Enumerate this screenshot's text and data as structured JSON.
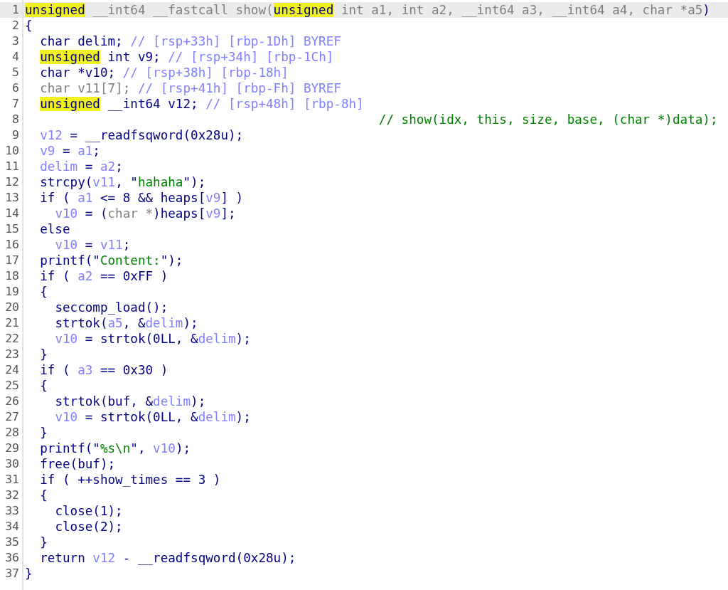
{
  "pseudocode": {
    "lines": [
      {
        "number": "1",
        "selected": true,
        "tokens": [
          {
            "kind": "highlight",
            "text": "unsigned"
          },
          {
            "kind": "dim",
            "text": " __int64 __fastcall show("
          },
          {
            "kind": "highlight",
            "text": "unsigned"
          },
          {
            "kind": "dim",
            "text": " int a1, int a2, __int64 a3, __int64 a4, char *a5"
          },
          {
            "kind": "code",
            "text": ")"
          }
        ]
      },
      {
        "number": "2",
        "selected": false,
        "tokens": [
          {
            "kind": "code",
            "text": "{"
          }
        ]
      },
      {
        "number": "3",
        "selected": false,
        "tokens": [
          {
            "kind": "code",
            "text": "  char delim; "
          },
          {
            "kind": "comment",
            "text": "// [rsp+33h] [rbp-1Dh] BYREF"
          }
        ]
      },
      {
        "number": "4",
        "selected": false,
        "tokens": [
          {
            "kind": "highlight",
            "text": "  unsigned"
          },
          {
            "kind": "code",
            "text": " int v9; "
          },
          {
            "kind": "comment",
            "text": "// [rsp+34h] [rbp-1Ch]"
          }
        ]
      },
      {
        "number": "5",
        "selected": false,
        "tokens": [
          {
            "kind": "code",
            "text": "  char *v10; "
          },
          {
            "kind": "comment",
            "text": "// [rsp+38h] [rbp-18h]"
          }
        ]
      },
      {
        "number": "6",
        "selected": false,
        "tokens": [
          {
            "kind": "dim",
            "text": "  char v11[7]; "
          },
          {
            "kind": "comment",
            "text": "// [rsp+41h] [rbp-Fh] BYREF"
          }
        ]
      },
      {
        "number": "7",
        "selected": false,
        "tokens": [
          {
            "kind": "highlight",
            "text": "  unsigned"
          },
          {
            "kind": "code",
            "text": " __int64 v12; "
          },
          {
            "kind": "comment",
            "text": "// [rsp+48h] [rbp-8h]"
          }
        ]
      },
      {
        "number": "8",
        "selected": false,
        "tokens": [
          {
            "kind": "note",
            "text": "                                               // show(idx, this, size, base, (char *)data);"
          }
        ]
      },
      {
        "number": "9",
        "selected": false,
        "tokens": [
          {
            "kind": "var",
            "text": "  v12"
          },
          {
            "kind": "code",
            "text": " = __readfsqword(0x28u);"
          }
        ]
      },
      {
        "number": "10",
        "selected": false,
        "tokens": [
          {
            "kind": "var",
            "text": "  v9"
          },
          {
            "kind": "code",
            "text": " = "
          },
          {
            "kind": "var",
            "text": "a1"
          },
          {
            "kind": "code",
            "text": ";"
          }
        ]
      },
      {
        "number": "11",
        "selected": false,
        "tokens": [
          {
            "kind": "var",
            "text": "  delim"
          },
          {
            "kind": "code",
            "text": " = "
          },
          {
            "kind": "var",
            "text": "a2"
          },
          {
            "kind": "code",
            "text": ";"
          }
        ]
      },
      {
        "number": "12",
        "selected": false,
        "tokens": [
          {
            "kind": "code",
            "text": "  strcpy("
          },
          {
            "kind": "var",
            "text": "v11"
          },
          {
            "kind": "code",
            "text": ", \""
          },
          {
            "kind": "string",
            "text": "hahaha"
          },
          {
            "kind": "code",
            "text": "\");"
          }
        ]
      },
      {
        "number": "13",
        "selected": false,
        "tokens": [
          {
            "kind": "code",
            "text": "  if ( "
          },
          {
            "kind": "var",
            "text": "a1"
          },
          {
            "kind": "code",
            "text": " <= 8 && heaps["
          },
          {
            "kind": "var",
            "text": "v9"
          },
          {
            "kind": "code",
            "text": "] )"
          }
        ]
      },
      {
        "number": "14",
        "selected": false,
        "tokens": [
          {
            "kind": "var",
            "text": "    v10"
          },
          {
            "kind": "code",
            "text": " = ("
          },
          {
            "kind": "dim",
            "text": "char *"
          },
          {
            "kind": "code",
            "text": ")heaps["
          },
          {
            "kind": "var",
            "text": "v9"
          },
          {
            "kind": "code",
            "text": "];"
          }
        ]
      },
      {
        "number": "15",
        "selected": false,
        "tokens": [
          {
            "kind": "code",
            "text": "  else"
          }
        ]
      },
      {
        "number": "16",
        "selected": false,
        "tokens": [
          {
            "kind": "var",
            "text": "    v10"
          },
          {
            "kind": "code",
            "text": " = "
          },
          {
            "kind": "var",
            "text": "v11"
          },
          {
            "kind": "code",
            "text": ";"
          }
        ]
      },
      {
        "number": "17",
        "selected": false,
        "tokens": [
          {
            "kind": "code",
            "text": "  printf(\""
          },
          {
            "kind": "string",
            "text": "Content:"
          },
          {
            "kind": "code",
            "text": "\");"
          }
        ]
      },
      {
        "number": "18",
        "selected": false,
        "tokens": [
          {
            "kind": "code",
            "text": "  if ( "
          },
          {
            "kind": "var",
            "text": "a2"
          },
          {
            "kind": "code",
            "text": " == 0xFF )"
          }
        ]
      },
      {
        "number": "19",
        "selected": false,
        "tokens": [
          {
            "kind": "code",
            "text": "  {"
          }
        ]
      },
      {
        "number": "20",
        "selected": false,
        "tokens": [
          {
            "kind": "code",
            "text": "    seccomp_load();"
          }
        ]
      },
      {
        "number": "21",
        "selected": false,
        "tokens": [
          {
            "kind": "code",
            "text": "    strtok("
          },
          {
            "kind": "var",
            "text": "a5"
          },
          {
            "kind": "code",
            "text": ", &"
          },
          {
            "kind": "var",
            "text": "delim"
          },
          {
            "kind": "code",
            "text": ");"
          }
        ]
      },
      {
        "number": "22",
        "selected": false,
        "tokens": [
          {
            "kind": "var",
            "text": "    v10"
          },
          {
            "kind": "code",
            "text": " = strtok(0LL, &"
          },
          {
            "kind": "var",
            "text": "delim"
          },
          {
            "kind": "code",
            "text": ");"
          }
        ]
      },
      {
        "number": "23",
        "selected": false,
        "tokens": [
          {
            "kind": "code",
            "text": "  }"
          }
        ]
      },
      {
        "number": "24",
        "selected": false,
        "tokens": [
          {
            "kind": "code",
            "text": "  if ( "
          },
          {
            "kind": "var",
            "text": "a3"
          },
          {
            "kind": "code",
            "text": " == 0x30 )"
          }
        ]
      },
      {
        "number": "25",
        "selected": false,
        "tokens": [
          {
            "kind": "code",
            "text": "  {"
          }
        ]
      },
      {
        "number": "26",
        "selected": false,
        "tokens": [
          {
            "kind": "code",
            "text": "    strtok(buf, &"
          },
          {
            "kind": "var",
            "text": "delim"
          },
          {
            "kind": "code",
            "text": ");"
          }
        ]
      },
      {
        "number": "27",
        "selected": false,
        "tokens": [
          {
            "kind": "var",
            "text": "    v10"
          },
          {
            "kind": "code",
            "text": " = strtok(0LL, &"
          },
          {
            "kind": "var",
            "text": "delim"
          },
          {
            "kind": "code",
            "text": ");"
          }
        ]
      },
      {
        "number": "28",
        "selected": false,
        "tokens": [
          {
            "kind": "code",
            "text": "  }"
          }
        ]
      },
      {
        "number": "29",
        "selected": false,
        "tokens": [
          {
            "kind": "code",
            "text": "  printf(\""
          },
          {
            "kind": "string",
            "text": "%s\\n"
          },
          {
            "kind": "code",
            "text": "\", "
          },
          {
            "kind": "var",
            "text": "v10"
          },
          {
            "kind": "code",
            "text": ");"
          }
        ]
      },
      {
        "number": "30",
        "selected": false,
        "tokens": [
          {
            "kind": "code",
            "text": "  free(buf);"
          }
        ]
      },
      {
        "number": "31",
        "selected": false,
        "tokens": [
          {
            "kind": "code",
            "text": "  if ( ++show_times == 3 )"
          }
        ]
      },
      {
        "number": "32",
        "selected": false,
        "tokens": [
          {
            "kind": "code",
            "text": "  {"
          }
        ]
      },
      {
        "number": "33",
        "selected": false,
        "tokens": [
          {
            "kind": "code",
            "text": "    close(1);"
          }
        ]
      },
      {
        "number": "34",
        "selected": false,
        "tokens": [
          {
            "kind": "code",
            "text": "    close(2);"
          }
        ]
      },
      {
        "number": "35",
        "selected": false,
        "tokens": [
          {
            "kind": "code",
            "text": "  }"
          }
        ]
      },
      {
        "number": "36",
        "selected": false,
        "tokens": [
          {
            "kind": "code",
            "text": "  return "
          },
          {
            "kind": "var",
            "text": "v12"
          },
          {
            "kind": "code",
            "text": " - __readfsqword(0x28u);"
          }
        ]
      },
      {
        "number": "37",
        "selected": false,
        "tokens": [
          {
            "kind": "code",
            "text": "}"
          }
        ]
      }
    ]
  }
}
